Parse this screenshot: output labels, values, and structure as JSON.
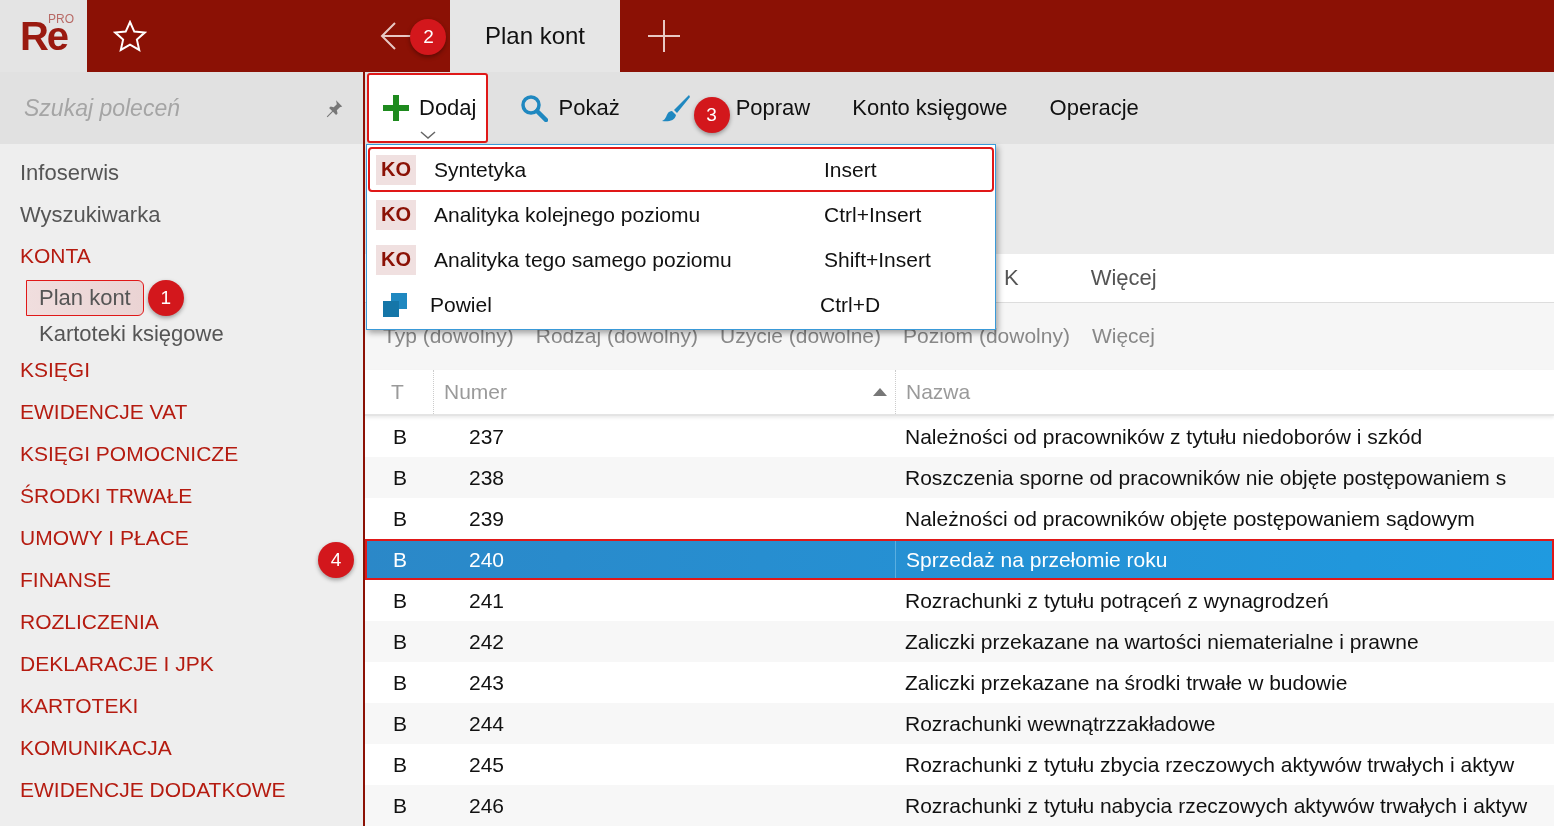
{
  "app": {
    "logo": "Re",
    "logo_badge": "PRO"
  },
  "tabs": [
    {
      "label": "Plan kont",
      "selected": true
    }
  ],
  "sidebar": {
    "search": {
      "placeholder": "Szukaj poleceń"
    },
    "items": [
      {
        "label": "Infoserwis",
        "kind": "link"
      },
      {
        "label": "Wyszukiwarka",
        "kind": "link"
      },
      {
        "label": "KONTA",
        "kind": "group",
        "children": [
          {
            "label": "Plan kont",
            "selected": true,
            "highlighted": true,
            "callout": "1"
          },
          {
            "label": "Kartoteki księgowe",
            "selected": false,
            "highlighted": false
          }
        ]
      },
      {
        "label": "KSIĘGI",
        "kind": "group"
      },
      {
        "label": "EWIDENCJE VAT",
        "kind": "group"
      },
      {
        "label": "KSIĘGI POMOCNICZE",
        "kind": "group"
      },
      {
        "label": "ŚRODKI TRWAŁE",
        "kind": "group"
      },
      {
        "label": "UMOWY I PŁACE",
        "kind": "group"
      },
      {
        "label": "FINANSE",
        "kind": "group"
      },
      {
        "label": "ROZLICZENIA",
        "kind": "group"
      },
      {
        "label": "DEKLARACJE I JPK",
        "kind": "group"
      },
      {
        "label": "KARTOTEKI",
        "kind": "group"
      },
      {
        "label": "KOMUNIKACJA",
        "kind": "group"
      },
      {
        "label": "EWIDENCJE DODATKOWE",
        "kind": "group"
      }
    ]
  },
  "toolbar": [
    {
      "label": "Dodaj",
      "highlighted": true,
      "callout": "2"
    },
    {
      "label": "Pokaż",
      "highlighted": false
    },
    {
      "label": "Popraw",
      "highlighted": false,
      "callout": "3"
    },
    {
      "label": "Konto księgowe",
      "highlighted": false
    },
    {
      "label": "Operacje",
      "highlighted": false
    }
  ],
  "dropdown": [
    {
      "kind": "tag",
      "tag": "KO",
      "label": "Syntetyka",
      "shortcut": "Insert",
      "highlighted": true
    },
    {
      "kind": "tag",
      "tag": "KO",
      "label": "Analityka kolejnego poziomu",
      "shortcut": "Ctrl+Insert",
      "highlighted": false
    },
    {
      "kind": "tag",
      "tag": "KO",
      "label": "Analityka tego samego poziomu",
      "shortcut": "Shift+Insert",
      "highlighted": false
    },
    {
      "kind": "icon",
      "label": "Powiel",
      "shortcut": "Ctrl+D",
      "highlighted": false
    }
  ],
  "view_tabs": [
    "K",
    "Więcej"
  ],
  "filters": [
    "Typ (dowolny)",
    "Rodzaj (dowolny)",
    "Użycie (dowolne)",
    "Poziom (dowolny)",
    "Więcej"
  ],
  "table": {
    "columns": [
      {
        "label": "T"
      },
      {
        "label": "Numer",
        "sorted": true
      },
      {
        "label": "Nazwa"
      }
    ],
    "rows": [
      {
        "type": "B",
        "number": "237",
        "name": "Należności od pracowników z tytułu niedoborów i szkód",
        "selected": false
      },
      {
        "type": "B",
        "number": "238",
        "name": "Roszczenia sporne od pracowników nie objęte postępowaniem s",
        "selected": false
      },
      {
        "type": "B",
        "number": "239",
        "name": "Należności od pracowników objęte postępowaniem sądowym",
        "selected": false
      },
      {
        "type": "B",
        "number": "240",
        "name": "Sprzedaż na przełomie roku",
        "selected": true,
        "callout": "4"
      },
      {
        "type": "B",
        "number": "241",
        "name": "Rozrachunki z tytułu potrąceń z wynagrodzeń",
        "selected": false
      },
      {
        "type": "B",
        "number": "242",
        "name": "Zaliczki przekazane na wartości niematerialne i prawne",
        "selected": false
      },
      {
        "type": "B",
        "number": "243",
        "name": "Zaliczki przekazane na środki trwałe w budowie",
        "selected": false
      },
      {
        "type": "B",
        "number": "244",
        "name": "Rozrachunki wewnątrzzakładowe",
        "selected": false
      },
      {
        "type": "B",
        "number": "245",
        "name": "Rozrachunki z tytułu zbycia rzeczowych aktywów trwałych i aktyw",
        "selected": false
      },
      {
        "type": "B",
        "number": "246",
        "name": "Rozrachunki z tytułu nabycia rzeczowych aktywów trwałych i aktyw",
        "selected": false
      }
    ]
  }
}
